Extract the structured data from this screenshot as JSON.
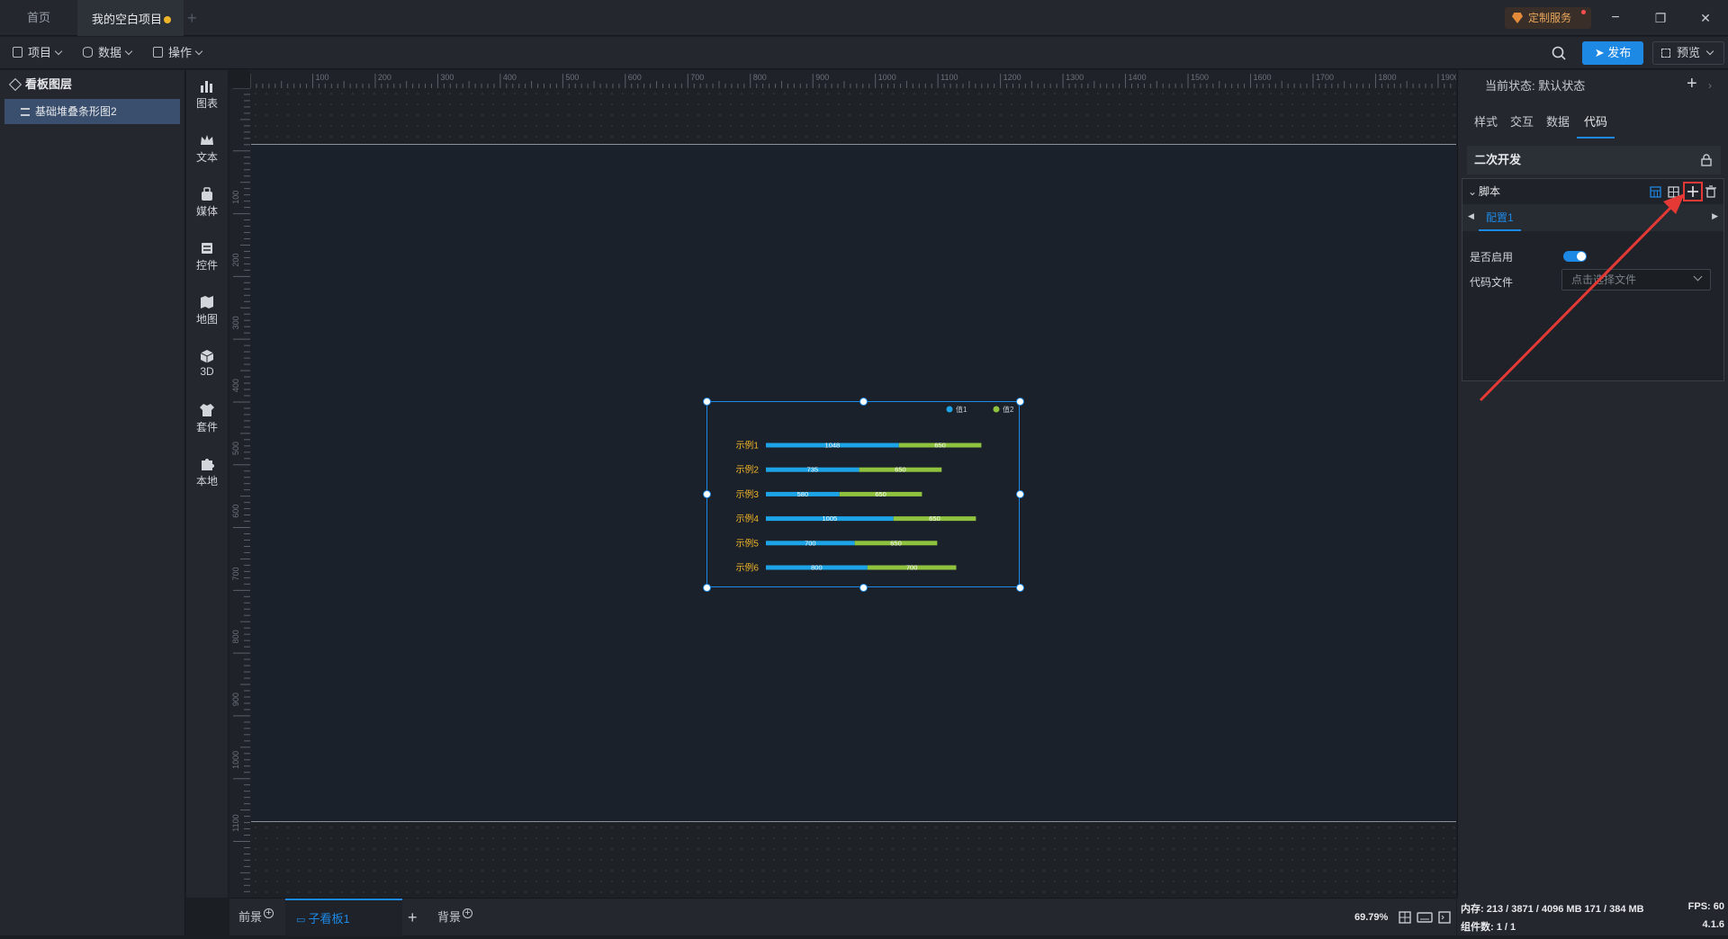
{
  "tabs": {
    "home": "首页",
    "project": "我的空白项目",
    "add": "+"
  },
  "custom_service": "定制服务",
  "window": {
    "minimize": "−",
    "restore": "❐",
    "close": "✕"
  },
  "toolbar": {
    "project": "项目",
    "data": "数据",
    "operate": "操作",
    "publish": "发布",
    "preview": "预览"
  },
  "layers": {
    "title": "看板图层",
    "item": "基础堆叠条形图2"
  },
  "iconbar": {
    "chart": "图表",
    "text": "文本",
    "media": "媒体",
    "control": "控件",
    "map": "地图",
    "three_d": "3D",
    "suite": "套件",
    "local": "本地"
  },
  "ruler": {
    "top": [
      "100",
      "200",
      "300",
      "400",
      "500",
      "600",
      "700",
      "800",
      "900",
      "1000",
      "1100",
      "1200",
      "1300",
      "1400",
      "1500",
      "1600",
      "1700",
      "1800",
      "1900"
    ],
    "left": [
      "100",
      "200",
      "300",
      "400",
      "500",
      "600",
      "700",
      "800",
      "900",
      "1000",
      "1100"
    ]
  },
  "bottom": {
    "foreground": "前景",
    "sub_board": "子看板1",
    "add": "+",
    "background": "背景",
    "zoom": "69.79%"
  },
  "right": {
    "state_label": "当前状态: 默认状态",
    "add": "+",
    "tabs": [
      "样式",
      "交互",
      "数据",
      "代码"
    ],
    "secondary_dev": "二次开发",
    "script": "脚本",
    "config_tab": "配置1",
    "enable_label": "是否启用",
    "file_label": "代码文件",
    "file_placeholder": "点击选择文件"
  },
  "status": {
    "memory": "内存: 213 / 3871 / 4096 MB  171 / 384 MB",
    "fps": "FPS: 60",
    "components": "组件数: 1 / 1",
    "version": "4.1.6"
  },
  "chart_data": {
    "type": "bar",
    "orientation": "horizontal",
    "stacked": true,
    "categories": [
      "示例1",
      "示例2",
      "示例3",
      "示例4",
      "示例5",
      "示例6"
    ],
    "series": [
      {
        "name": "值1",
        "values": [
          1048,
          735,
          580,
          1005,
          700,
          800
        ],
        "color": "#1ca4e6"
      },
      {
        "name": "值2",
        "values": [
          650,
          650,
          650,
          650,
          650,
          700
        ],
        "color": "#8fc33f"
      }
    ],
    "legend": "top-right",
    "label_color": "#f0b429"
  }
}
